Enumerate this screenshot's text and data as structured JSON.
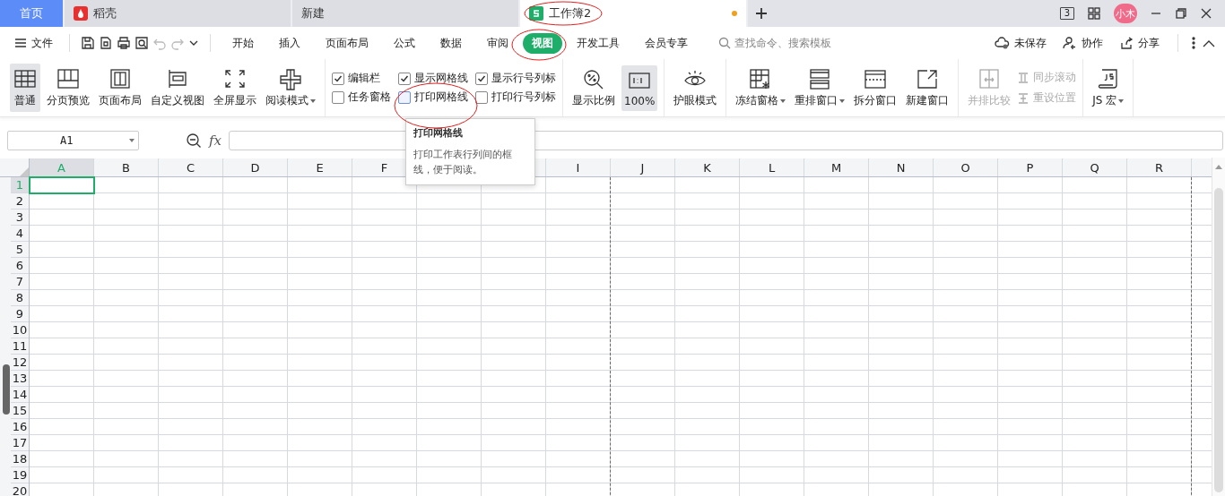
{
  "tabs": [
    {
      "label": "首页",
      "kind": "home",
      "selected": false
    },
    {
      "label": "稻壳",
      "kind": "docer",
      "selected": false
    },
    {
      "label": "新建",
      "kind": "blank",
      "selected": false
    },
    {
      "label": "工作簿2",
      "kind": "sheet",
      "selected": true,
      "modified": true
    }
  ],
  "window_controls": {
    "layout_badge": "3",
    "avatar": "小木"
  },
  "menu": {
    "file": "文件",
    "tabs": [
      {
        "label": "开始",
        "selected": false
      },
      {
        "label": "插入",
        "selected": false
      },
      {
        "label": "页面布局",
        "selected": false
      },
      {
        "label": "公式",
        "selected": false
      },
      {
        "label": "数据",
        "selected": false
      },
      {
        "label": "审阅",
        "selected": false
      },
      {
        "label": "视图",
        "selected": true
      },
      {
        "label": "开发工具",
        "selected": false
      },
      {
        "label": "会员专享",
        "selected": false
      }
    ],
    "search": {
      "placeholder": "查找命令、搜索模板"
    },
    "actions": [
      "未保存",
      "协作",
      "分享"
    ]
  },
  "ribbon": {
    "groups": [
      {
        "kind": "buttons",
        "items": [
          {
            "kind": "large",
            "label": "普通",
            "selected": true
          },
          {
            "kind": "large",
            "label": "分页预览",
            "selected": false
          },
          {
            "kind": "large",
            "label": "页面布局",
            "selected": false
          },
          {
            "kind": "large",
            "label": "自定义视图",
            "selected": false
          },
          {
            "kind": "large",
            "label": "全屏显示",
            "selected": false
          },
          {
            "kind": "large",
            "label": "阅读模式",
            "selected": false,
            "dropdown": true
          }
        ]
      },
      {
        "kind": "checks",
        "items": [
          {
            "label": "编辑栏",
            "checked": true
          },
          {
            "label": "任务窗格",
            "checked": false
          },
          {
            "label": "显示网格线",
            "checked": true
          },
          {
            "label": "打印网格线",
            "checked": false,
            "hovered": true
          },
          {
            "label": "显示行号列标",
            "checked": true
          },
          {
            "label": "打印行号列标",
            "checked": false
          }
        ]
      },
      {
        "kind": "buttons",
        "items": [
          {
            "kind": "large",
            "label": "显示比例",
            "selected": false
          },
          {
            "kind": "large",
            "label": "100%",
            "selected": true
          }
        ]
      },
      {
        "kind": "buttons",
        "items": [
          {
            "kind": "large",
            "label": "护眼模式",
            "selected": false
          }
        ]
      },
      {
        "kind": "buttons",
        "items": [
          {
            "kind": "large",
            "label": "冻结窗格",
            "selected": false,
            "dropdown": true
          },
          {
            "kind": "large",
            "label": "重排窗口",
            "selected": false,
            "dropdown": true
          },
          {
            "kind": "large",
            "label": "拆分窗口",
            "selected": false
          },
          {
            "kind": "large",
            "label": "新建窗口",
            "selected": false
          }
        ]
      },
      {
        "kind": "buttons",
        "items": [
          {
            "kind": "large",
            "label": "并排比较",
            "selected": false,
            "disabled": true
          },
          {
            "kind": "small",
            "label": "同步滚动",
            "disabled": true
          },
          {
            "kind": "small",
            "label": "重设位置",
            "disabled": true
          }
        ]
      },
      {
        "kind": "buttons",
        "items": [
          {
            "kind": "large",
            "label": "JS 宏",
            "selected": false,
            "dropdown": true
          }
        ]
      }
    ]
  },
  "formula_bar": {
    "name_box": "A1",
    "fx": "fx"
  },
  "tooltip": {
    "title": "打印网格线",
    "body": "打印工作表行列间的框线，便于阅读。"
  },
  "sheet": {
    "columns": [
      {
        "label": "A",
        "selected": true
      },
      {
        "label": "B",
        "selected": false
      },
      {
        "label": "C",
        "selected": false
      },
      {
        "label": "D",
        "selected": false
      },
      {
        "label": "E",
        "selected": false
      },
      {
        "label": "F",
        "selected": false
      },
      {},
      {},
      {
        "label": "I",
        "selected": false,
        "page_break_after": true
      },
      {
        "label": "J",
        "selected": false
      },
      {
        "label": "K",
        "selected": false
      },
      {
        "label": "L",
        "selected": false
      },
      {
        "label": "M",
        "selected": false
      },
      {
        "label": "N",
        "selected": false
      },
      {
        "label": "O",
        "selected": false
      },
      {
        "label": "P",
        "selected": false
      },
      {
        "label": "Q",
        "selected": false
      },
      {
        "label": "R",
        "selected": false,
        "page_break_after": true
      }
    ],
    "rows": [
      {
        "label": "1",
        "selected": true
      },
      {
        "label": "2",
        "selected": false
      },
      {
        "label": "3",
        "selected": false
      },
      {
        "label": "4",
        "selected": false
      },
      {
        "label": "5",
        "selected": false
      },
      {
        "label": "6",
        "selected": false
      },
      {
        "label": "7",
        "selected": false
      },
      {
        "label": "8",
        "selected": false
      },
      {
        "label": "9",
        "selected": false
      },
      {
        "label": "10",
        "selected": false
      },
      {
        "label": "11",
        "selected": false
      },
      {
        "label": "12",
        "selected": false
      },
      {
        "label": "13",
        "selected": false
      },
      {
        "label": "14",
        "selected": false
      },
      {
        "label": "15",
        "selected": false
      },
      {
        "label": "16",
        "selected": false
      },
      {
        "label": "17",
        "selected": false
      },
      {
        "label": "18",
        "selected": false
      },
      {
        "label": "19",
        "selected": false
      },
      {
        "label": "20",
        "selected": false
      }
    ]
  }
}
